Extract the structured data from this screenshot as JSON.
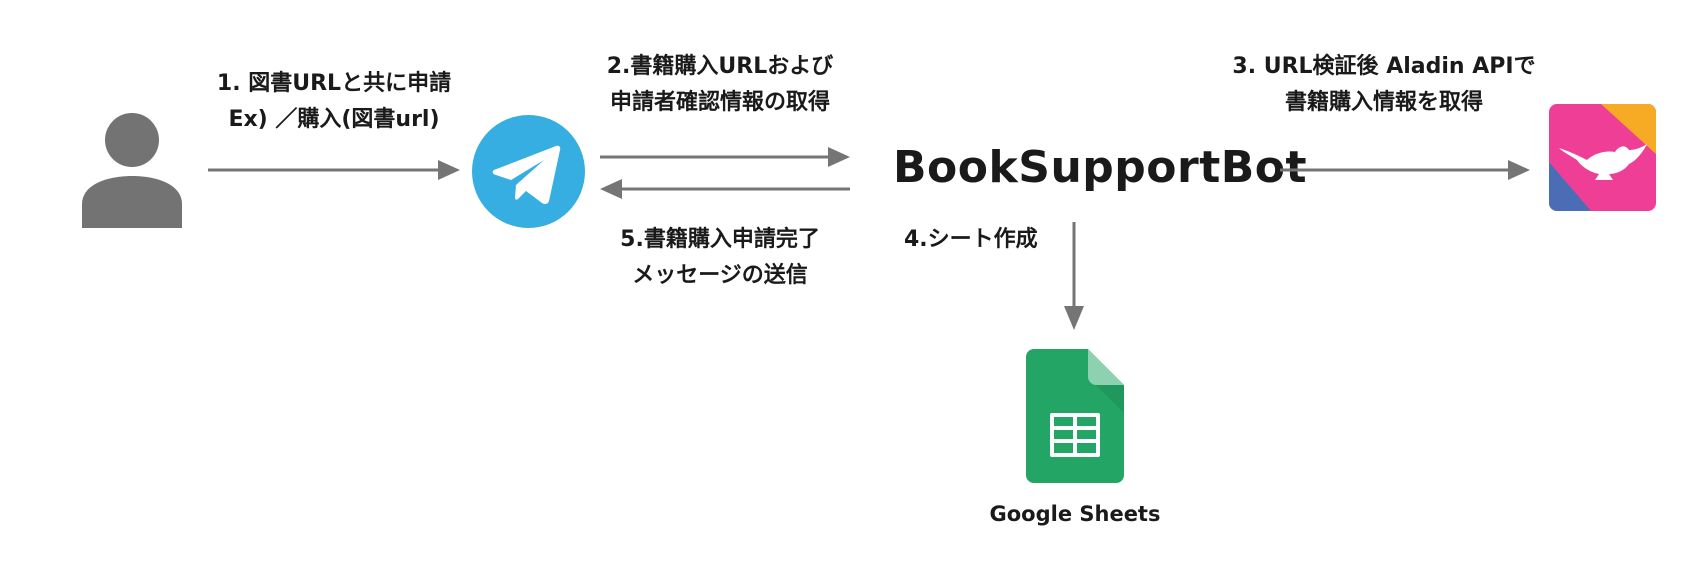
{
  "diagram": {
    "nodes": {
      "user": {
        "icon": "user-icon"
      },
      "telegram": {
        "icon": "telegram-icon",
        "color": "#37aee2"
      },
      "bot": {
        "name": "BookSupportBot"
      },
      "aladin": {
        "icon": "aladin-icon",
        "color": "#ef3e96"
      },
      "sheets": {
        "icon": "google-sheets-icon",
        "caption": "Google Sheets",
        "color": "#23a566"
      }
    },
    "steps": {
      "step1": {
        "line1": "1. 図書URLと共に申請",
        "line2": "Ex) ／購入(図書url)"
      },
      "step2": {
        "line1": "2.書籍購入URLおよび",
        "line2": "申請者確認情報の取得"
      },
      "step3": {
        "line1": "3. URL検証後 Aladin APIで",
        "line2": "書籍購入情報を取得"
      },
      "step4": {
        "line1": "4.シート作成"
      },
      "step5": {
        "line1": "5.書籍購入申請完了",
        "line2": "メッセージの送信"
      }
    },
    "arrow_color": "#757575"
  }
}
